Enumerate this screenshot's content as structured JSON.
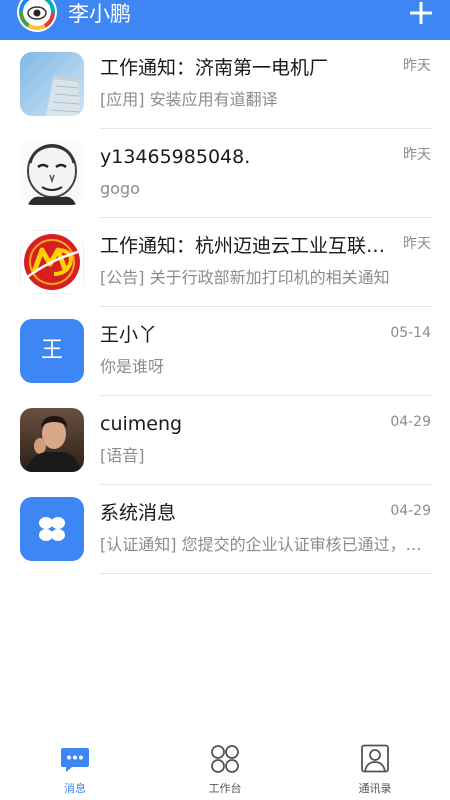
{
  "header": {
    "title": "李小鹏",
    "add_icon": "plus-icon",
    "avatar_icon": "rainbow-eye-logo"
  },
  "colors": {
    "primary": "#3d86f3",
    "divider": "#e6e6e6",
    "secondary_text": "#8c8c8c"
  },
  "conversations": [
    {
      "name": "工作通知：济南第一电机厂",
      "time": "昨天",
      "message": "[应用] 安装应用有道翻译",
      "icon": "building-photo-avatar"
    },
    {
      "name": "y13465985048.",
      "time": "昨天",
      "message": "gogo",
      "icon": "meme-face-avatar"
    },
    {
      "name": "工作通知：杭州迈迪云工业互联网有限公司",
      "time": "昨天",
      "message": "[公告] 关于行政部新加打印机的相关通知",
      "icon": "md-logo-avatar"
    },
    {
      "name": "王小丫",
      "time": "05-14",
      "message": "你是谁呀",
      "icon": "text-avatar",
      "avatar_text": "王"
    },
    {
      "name": "cuimeng",
      "time": "04-29",
      "message": "[语音]",
      "icon": "person-photo-avatar"
    },
    {
      "name": "系统消息",
      "time": "04-29",
      "message": "[认证通知] 您提交的企业认证审核已通过，欢迎使用",
      "icon": "four-petal-icon"
    }
  ],
  "tabs": [
    {
      "label": "消息",
      "icon": "chat-bubble-icon",
      "active": true
    },
    {
      "label": "工作台",
      "icon": "workbench-grid-icon",
      "active": false
    },
    {
      "label": "通讯录",
      "icon": "contacts-icon",
      "active": false
    }
  ]
}
